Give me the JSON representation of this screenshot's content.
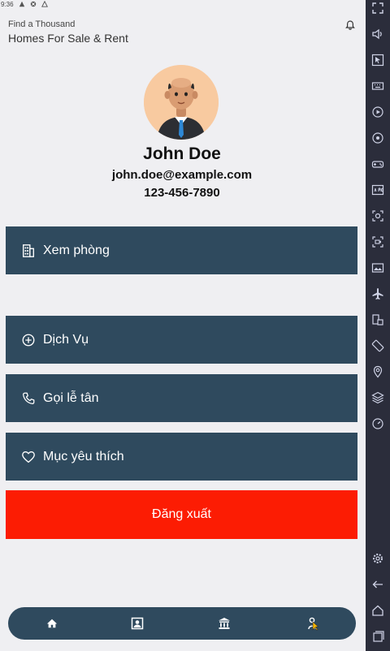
{
  "status_bar": {
    "time": "9:36"
  },
  "header": {
    "subtitle": "Find a Thousand",
    "title": "Homes For Sale & Rent"
  },
  "profile": {
    "name": "John Doe",
    "email": "john.doe@example.com",
    "phone": "123-456-7890"
  },
  "menu": {
    "rooms": {
      "label": "Xem phòng",
      "icon": "building-icon"
    },
    "services": {
      "label": "Dịch Vụ",
      "icon": "plus-circle-icon"
    },
    "reception": {
      "label": "Gọi lễ tân",
      "icon": "phone-icon"
    },
    "favorites": {
      "label": "Mục yêu thích",
      "icon": "heart-icon"
    }
  },
  "logout": {
    "label": "Đăng xuất"
  },
  "bottom_nav": {
    "items": [
      {
        "icon": "home-icon"
      },
      {
        "icon": "contact-card-icon"
      },
      {
        "icon": "bank-icon"
      },
      {
        "icon": "person-icon"
      }
    ]
  },
  "colors": {
    "primary": "#2f4a5e",
    "logout": "#fc1c03",
    "background": "#efeff2",
    "toolbar": "#2b2d3b"
  }
}
